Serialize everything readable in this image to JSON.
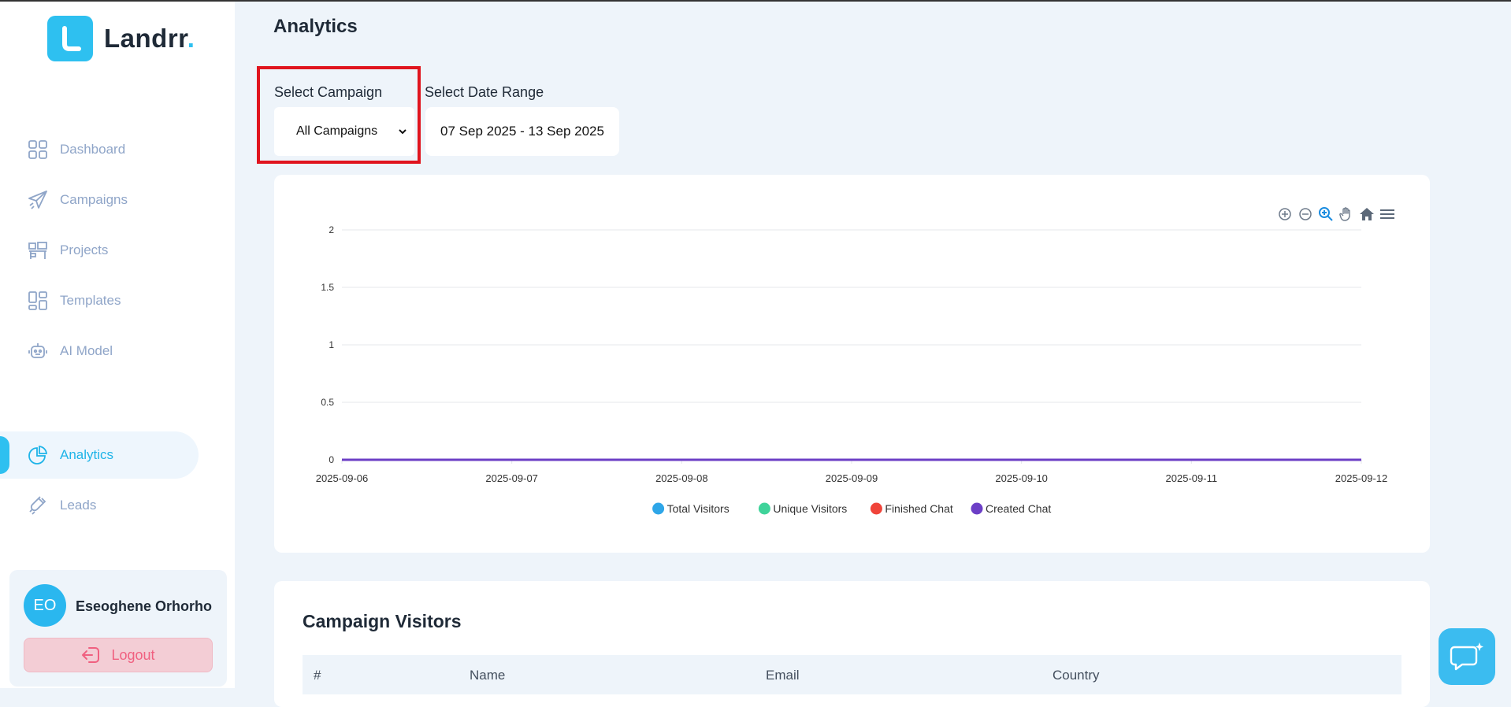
{
  "brand": {
    "name": "Landrr",
    "dot": "."
  },
  "sidebar": {
    "items": [
      {
        "label": "Dashboard",
        "icon": "grid-icon"
      },
      {
        "label": "Campaigns",
        "icon": "paper-plane-icon"
      },
      {
        "label": "Projects",
        "icon": "desk-icon"
      },
      {
        "label": "Templates",
        "icon": "layout-icon"
      },
      {
        "label": "AI Model",
        "icon": "robot-icon"
      },
      {
        "label": "Analytics",
        "icon": "pie-chart-icon",
        "active": true
      },
      {
        "label": "Leads",
        "icon": "magnet-icon"
      }
    ]
  },
  "user": {
    "initials": "EO",
    "name": "Eseoghene Orhorho",
    "logout_label": "Logout"
  },
  "main": {
    "title": "Analytics",
    "campaign": {
      "label": "Select Campaign",
      "value": "All Campaigns"
    },
    "date_range": {
      "label": "Select Date Range",
      "value": "07 Sep 2025 - 13 Sep 2025"
    },
    "visitors": {
      "title": "Campaign Visitors",
      "columns": [
        "#",
        "Name",
        "Email",
        "Country"
      ]
    }
  },
  "chart_data": {
    "type": "line",
    "x": [
      "2025-09-06",
      "2025-09-07",
      "2025-09-08",
      "2025-09-09",
      "2025-09-10",
      "2025-09-11",
      "2025-09-12"
    ],
    "y_ticks": [
      "2",
      "1.5",
      "1",
      "0.5",
      "0"
    ],
    "ylim": [
      0,
      2
    ],
    "grid": true,
    "legend_placement": "bottom-center",
    "series": [
      {
        "name": "Total Visitors",
        "color": "#2ea6e8",
        "values": [
          0,
          0,
          0,
          0,
          0,
          0,
          0
        ]
      },
      {
        "name": "Unique Visitors",
        "color": "#3fd39a",
        "values": [
          0,
          0,
          0,
          0,
          0,
          0,
          0
        ]
      },
      {
        "name": "Finished Chat",
        "color": "#f0443a",
        "values": [
          0,
          0,
          0,
          0,
          0,
          0,
          0
        ]
      },
      {
        "name": "Created Chat",
        "color": "#6c3fc6",
        "values": [
          0,
          0,
          0,
          0,
          0,
          0,
          0
        ]
      }
    ]
  }
}
